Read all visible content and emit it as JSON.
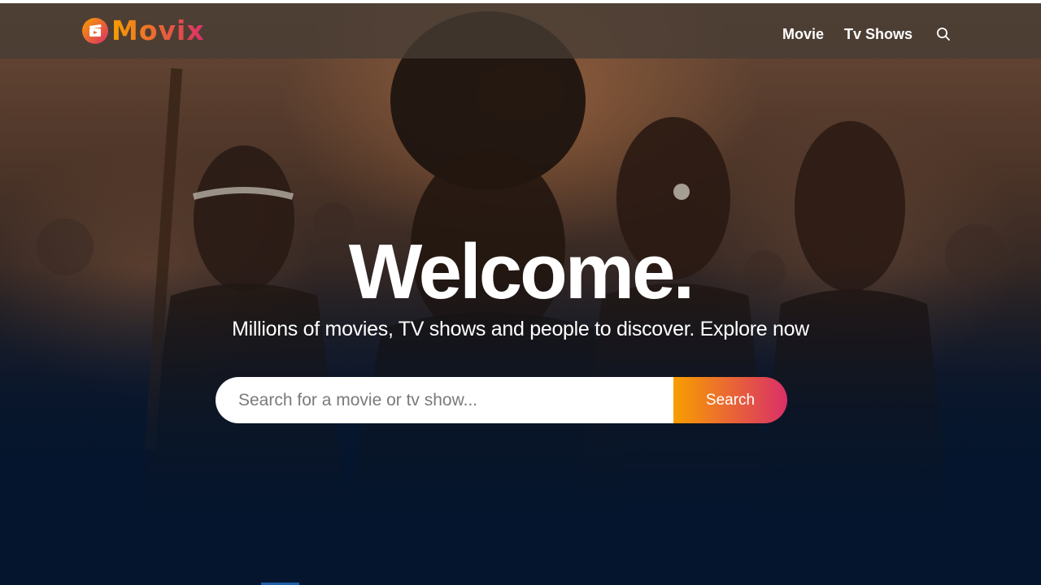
{
  "header": {
    "logo_text": "Movix",
    "nav": [
      {
        "label": "Movie"
      },
      {
        "label": "Tv Shows"
      }
    ]
  },
  "hero": {
    "title": "Welcome.",
    "subtitle": "Millions of movies, TV shows and people to discover. Explore now"
  },
  "search": {
    "placeholder": "Search for a movie or tv show...",
    "value": "",
    "button_label": "Search"
  },
  "icons": {
    "logo": "movie-clapper-icon",
    "search": "search-icon"
  },
  "colors": {
    "accent_start": "#f89e00",
    "accent_end": "#da2f68",
    "background": "#04152d",
    "header_bg": "#463c34",
    "text": "#ffffff"
  }
}
